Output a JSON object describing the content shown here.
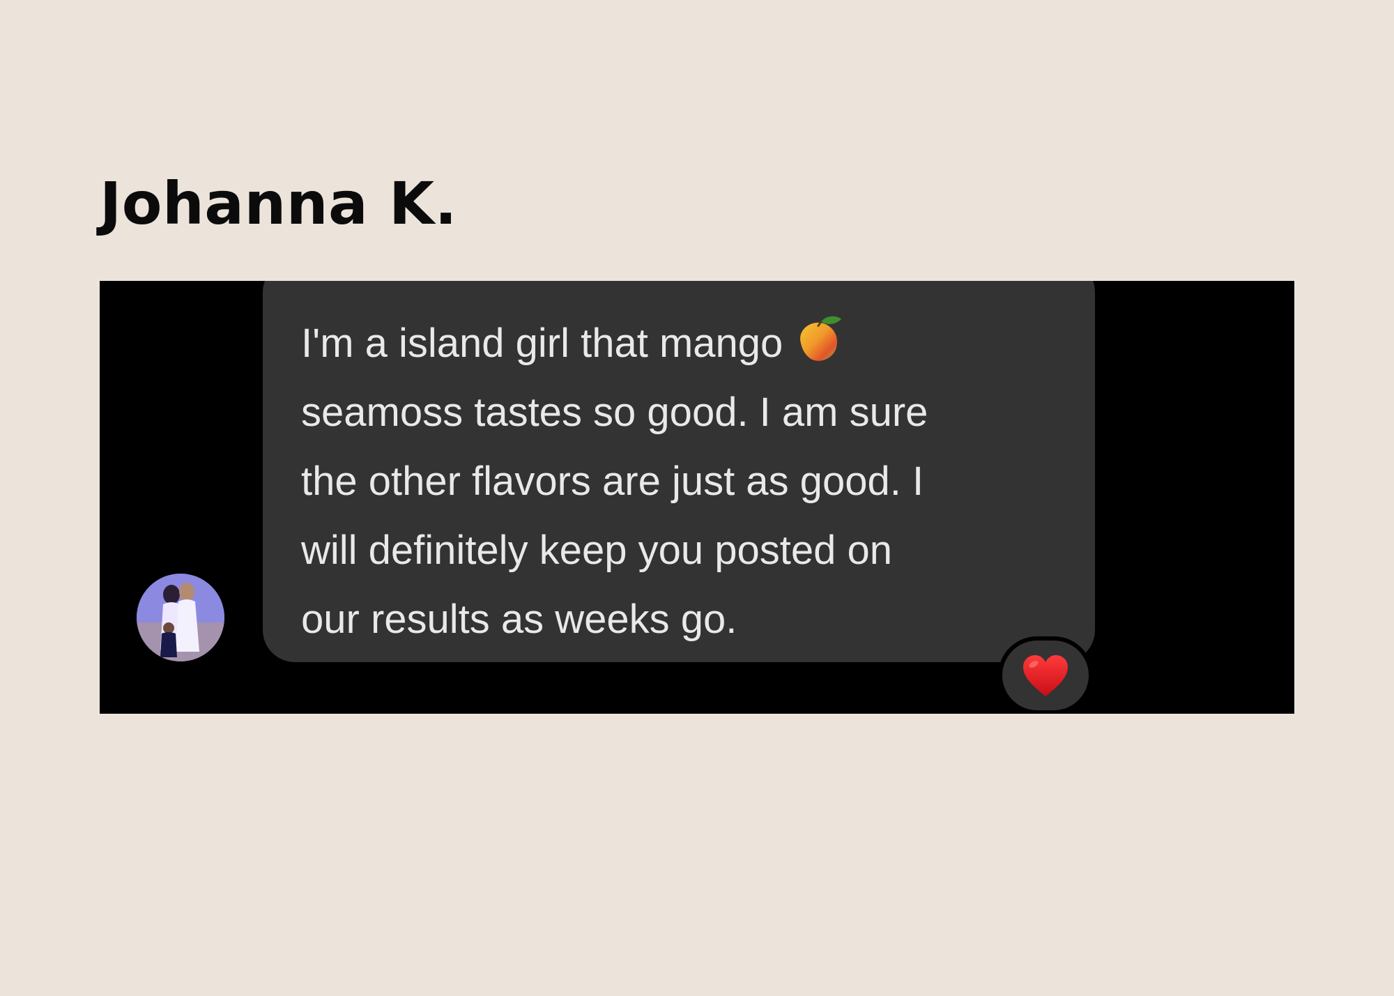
{
  "review": {
    "reviewer_name": "Johanna K."
  },
  "message": {
    "lines": [
      "I'm a island girl that mango",
      "seamoss tastes so good. I am sure",
      "the other flavors are just as good. I",
      "will definitely keep you posted on",
      "our results as weeks go."
    ],
    "inline_emoji": "mango-emoji",
    "reaction_icon": "heart-icon"
  },
  "colors": {
    "page_background": "#ece4db",
    "screenshot_background": "#000000",
    "bubble": "#333333",
    "message_text": "#e9e9e9",
    "heart": "#e0161e"
  }
}
